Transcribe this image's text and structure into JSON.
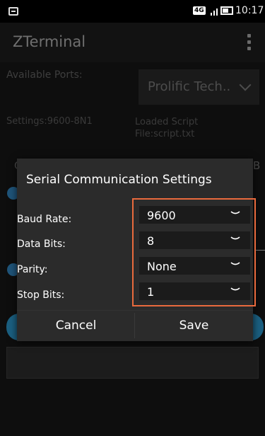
{
  "status_bar": {
    "network": "4G",
    "time": "10:17"
  },
  "app_bar": {
    "title": "ZTerminal",
    "overflow_icon": "more-vert-icon"
  },
  "background": {
    "available_ports_label": "Available Ports:",
    "port_selected": "Prolific Tech..",
    "settings_label": "Settings:9600-8N1",
    "loaded_script_label": "Loaded Script File:script.txt",
    "partial_left": "C",
    "partial_right": "B"
  },
  "dialog": {
    "title": "Serial Communication Settings",
    "fields": [
      {
        "label": "Baud Rate:",
        "value": "9600"
      },
      {
        "label": "Data Bits:",
        "value": "8"
      },
      {
        "label": "Parity:",
        "value": "None"
      },
      {
        "label": "Stop Bits:",
        "value": "1"
      }
    ],
    "cancel_label": "Cancel",
    "save_label": "Save",
    "highlight_color": "#e96a3d"
  }
}
